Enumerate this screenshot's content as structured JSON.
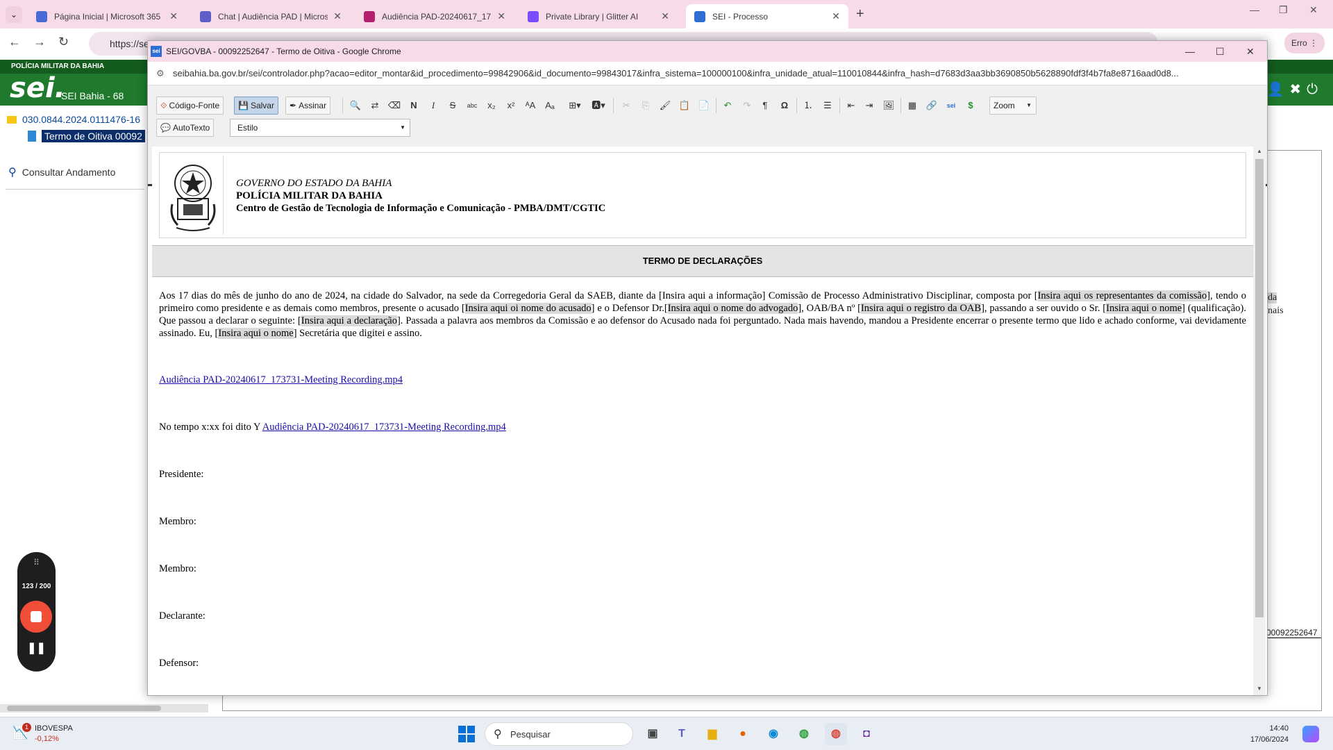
{
  "browser": {
    "tabs": [
      {
        "title": "Página Inicial | Microsoft 365",
        "favicon_color": "#4a6bd6",
        "active": false
      },
      {
        "title": "Chat | Audiência PAD | Microsof",
        "favicon_color": "#5b5fc7",
        "active": false
      },
      {
        "title": "Audiência PAD-20240617_1737",
        "favicon_color": "#b4206e",
        "active": false
      },
      {
        "title": "Private Library | Glitter AI",
        "favicon_color": "#7c4dff",
        "active": false
      },
      {
        "title": "SEI - Processo",
        "favicon_color": "#2e6fd6",
        "active": true
      }
    ],
    "new_tab": "+",
    "address": "https://se",
    "profile_button": "Erro"
  },
  "sei": {
    "org_strip": "POLÍCIA MILITAR DA BAHIA",
    "logo": "sei.",
    "unit": "SEI Bahia - 68",
    "process_number": "030.0844.2024.0111476-16",
    "document_item": "Termo de Oitiva 00092",
    "consult": "Consultar Andamento",
    "bg_text_1": "da",
    "bg_text_2": "nais",
    "bg_doc_id": "00092252647"
  },
  "popup": {
    "favicon": "sei",
    "title": "SEI/GOVBA - 00092252647 - Termo de Oitiva - Google Chrome",
    "url": "seibahia.ba.gov.br/sei/controlador.php?acao=editor_montar&id_procedimento=99842906&id_documento=99843017&infra_sistema=100000100&infra_unidade_atual=110010844&infra_hash=d7683d3aa3bb3690850b5628890fdf3f4b7fa8e8716aad0d8..."
  },
  "editor": {
    "codigo_fonte": "Código-Fonte",
    "salvar": "Salvar",
    "assinar": "Assinar",
    "zoom": "Zoom",
    "autotexto": "AutoTexto",
    "estilo": "Estilo"
  },
  "document": {
    "header_line1": "GOVERNO DO ESTADO DA BAHIA",
    "header_line2": "POLÍCIA MILITAR DA BAHIA",
    "header_line3": "Centro de Gestão de Tecnologia de Informação e Comunicação - PMBA/DMT/CGTIC",
    "title": "TERMO DE DECLARAÇÕES",
    "p1": "Aos 17 dias do mês de junho do ano de 2024, na cidade do Salvador, na sede da Corregedoria Geral da SAEB, diante da [Insira aqui a informação] Comissão de Processo Administrativo Disciplinar, composta por [",
    "ph1": "Insira aqui os representantes da comissão",
    "p2": "], tendo o primeiro como presidente e as demais como membros, presente o acusado [",
    "ph2": "Insira aqui oi nome do acusado",
    "p3": "] e o Defensor Dr.[",
    "ph3": "Insira aqui o nome do advogado",
    "p4": "], OAB/BA nº [",
    "ph4": "Insira aqui o registro da OAB",
    "p5": "], passando a ser ouvido o Sr. [",
    "ph5": "Insira aqui o nome",
    "p6": "] (qualificação). Que passou a declarar o seguinte: [",
    "ph6": "Insira aqui a declaração",
    "p7": "]. Passada a palavra aos membros da Comissão e ao defensor do Acusado nada foi perguntado. Nada mais havendo, mandou a Presidente encerrar o presente termo que lido e achado conforme, vai devidamente assinado. Eu, [",
    "ph7": "Insira aqui o nome",
    "p8": "] Secretária que digitei e assino.",
    "link1": "Audiência PAD-20240617_173731-Meeting Recording.mp4",
    "tempo_text": "No tempo x:xx foi dito Y ",
    "link2": "Audiência PAD-20240617_173731-Meeting Recording.mp4",
    "sig_presidente": "Presidente:",
    "sig_membro1": "Membro:",
    "sig_membro2": "Membro:",
    "sig_declarante": "Declarante:",
    "sig_defensor": "Defensor:"
  },
  "recorder": {
    "count": "123 / 200"
  },
  "taskbar": {
    "ticker_name": "IBOVESPA",
    "ticker_change": "-0,12%",
    "ticker_badge": "1",
    "search_placeholder": "Pesquisar",
    "time": "14:40",
    "date": "17/06/2024"
  }
}
